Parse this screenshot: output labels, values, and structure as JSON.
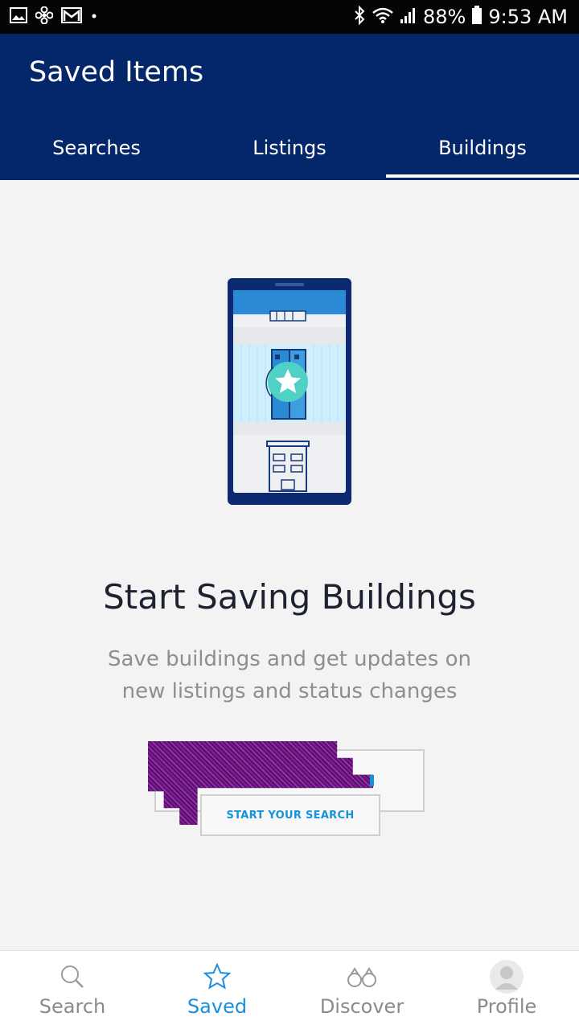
{
  "status_bar": {
    "battery": "88%",
    "time": "9:53 AM",
    "left_icons": [
      "image-icon",
      "fan-icon",
      "gmail-icon",
      "dot-icon"
    ],
    "right_icons": [
      "bluetooth-icon",
      "wifi-icon",
      "signal-icon",
      "battery-icon"
    ]
  },
  "app_bar": {
    "title": "Saved Items",
    "tabs": [
      {
        "label": "Searches",
        "selected": false
      },
      {
        "label": "Listings",
        "selected": false
      },
      {
        "label": "Buildings",
        "selected": true
      }
    ]
  },
  "empty_state": {
    "illustration_icon": "phone-building-star-icon",
    "headline": "Start Saving Buildings",
    "subtext": "Save buildings and get updates on new listings and status changes",
    "cta_label": "START YOUR SEARCH"
  },
  "bottom_nav": {
    "items": [
      {
        "label": "Search",
        "icon": "search-icon",
        "selected": false
      },
      {
        "label": "Saved",
        "icon": "star-icon",
        "selected": true
      },
      {
        "label": "Discover",
        "icon": "binoculars-icon",
        "selected": false
      },
      {
        "label": "Profile",
        "icon": "avatar-icon",
        "selected": false
      }
    ]
  },
  "colors": {
    "app_bar": "#03276a",
    "accent": "#1b8fd9",
    "background": "#f3f3f3"
  }
}
